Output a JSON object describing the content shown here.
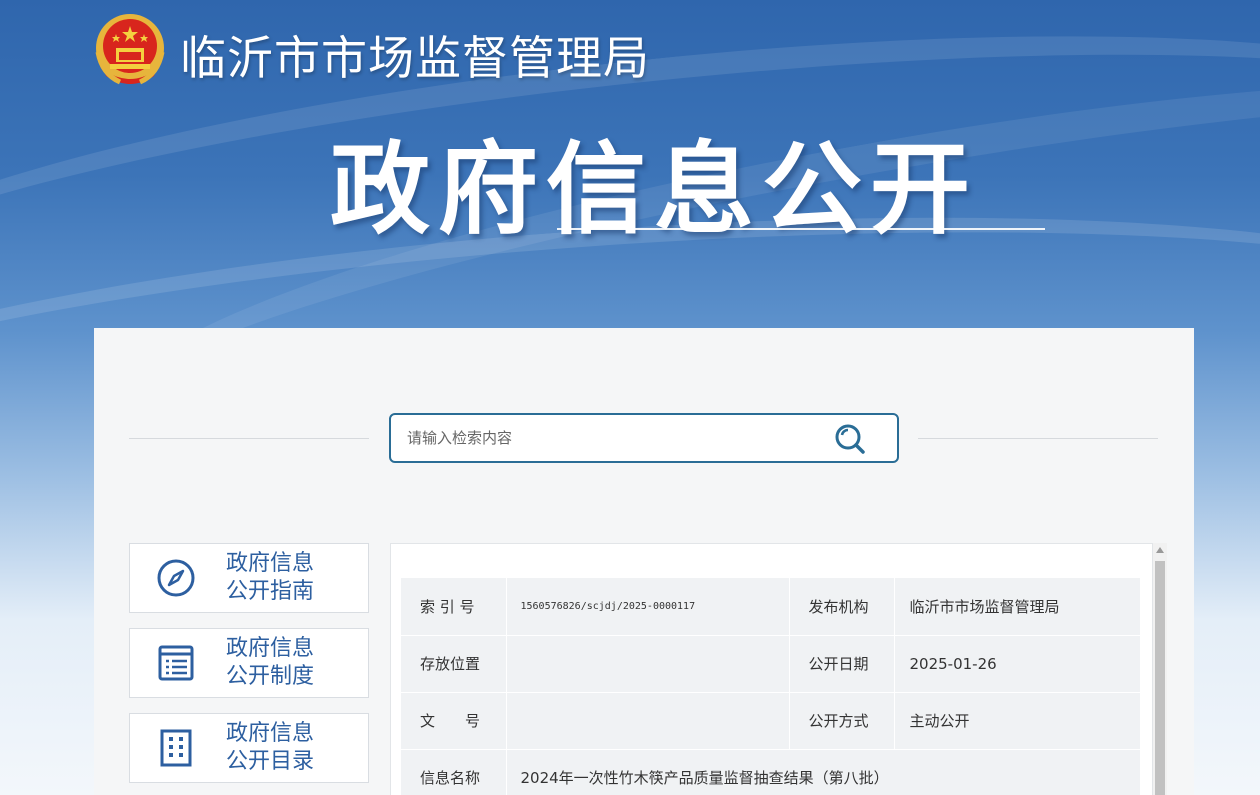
{
  "header": {
    "site_title": "临沂市市场监督管理局",
    "big_title": "政府信息公开"
  },
  "search": {
    "placeholder": "请输入检索内容"
  },
  "sidebar": {
    "items": [
      {
        "line1": "政府信息",
        "line2": "公开指南",
        "icon": "compass-icon"
      },
      {
        "line1": "政府信息",
        "line2": "公开制度",
        "icon": "list-document-icon"
      },
      {
        "line1": "政府信息",
        "line2": "公开目录",
        "icon": "building-grid-icon"
      }
    ]
  },
  "info": {
    "rows": [
      {
        "label": "索 引 号",
        "value": "1560576826/scjdj/2025-0000117",
        "label2": "发布机构",
        "value2": "临沂市市场监督管理局"
      },
      {
        "label": "存放位置",
        "value": "",
        "label2": "公开日期",
        "value2": "2025-01-26"
      },
      {
        "label": "文　　号",
        "value": "",
        "label2": "公开方式",
        "value2": "主动公开"
      },
      {
        "label": "信息名称",
        "value": "2024年一次性竹木筷产品质量监督抽查结果（第八批）"
      }
    ]
  },
  "colors": {
    "accent": "#2d5fa0",
    "search_border": "#2a6d96",
    "banner_top": "#2f66ad"
  }
}
